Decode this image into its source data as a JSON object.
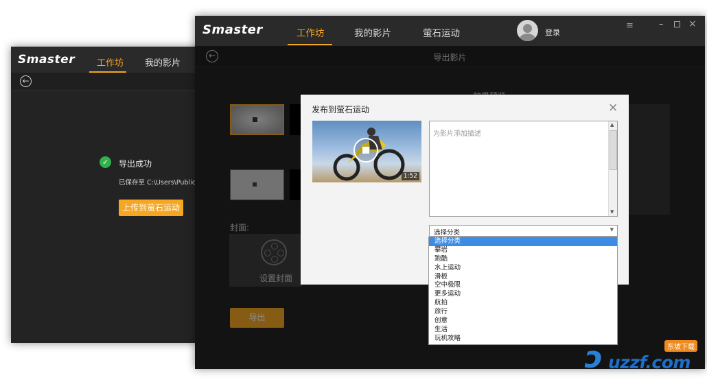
{
  "back_window": {
    "logo": "Smaster",
    "nav": [
      "工作坊",
      "我的影片"
    ],
    "success_title": "导出成功",
    "saved_path": "已保存至 C:\\Users\\Public\\Do",
    "upload_button": "上传到萤石运动"
  },
  "front_window": {
    "logo": "Smaster",
    "nav": [
      "工作坊",
      "我的影片",
      "萤石运动"
    ],
    "login": "登录",
    "window_controls": [
      "menu-icon",
      "minimize-icon",
      "maximize-icon",
      "close-icon"
    ],
    "subtitle": "导出影片",
    "preview_title_partial": "效果预览",
    "cover_label": "封面:",
    "set_cover": "设置封面",
    "export_button": "导出"
  },
  "dialog": {
    "title": "发布到萤石运动",
    "duration": "1:52",
    "description_placeholder": "为影片添加描述",
    "category_selected": "选择分类",
    "category_options": [
      "选择分类",
      "攀岩",
      "跑酷",
      "水上运动",
      "滑板",
      "空中极限",
      "更多运动",
      "航拍",
      "旅行",
      "创意",
      "生活",
      "玩机攻略"
    ]
  },
  "watermark": {
    "brand": "uzzf.com",
    "tag": "东坡下载"
  },
  "colors": {
    "accent": "#f5a623",
    "dark_bg": "#232323",
    "dialog_bg": "#f3f3f3",
    "selection": "#3c8ce6"
  }
}
